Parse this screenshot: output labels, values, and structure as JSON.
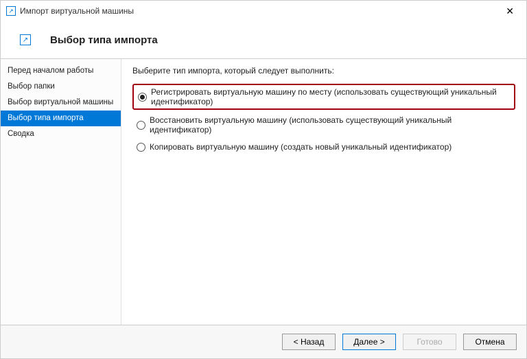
{
  "window": {
    "title": "Импорт виртуальной машины"
  },
  "header": {
    "title": "Выбор типа импорта"
  },
  "sidebar": {
    "steps": [
      {
        "label": "Перед началом работы",
        "selected": false
      },
      {
        "label": "Выбор папки",
        "selected": false
      },
      {
        "label": "Выбор виртуальной машины",
        "selected": false
      },
      {
        "label": "Выбор типа импорта",
        "selected": true
      },
      {
        "label": "Сводка",
        "selected": false
      }
    ]
  },
  "content": {
    "instruction": "Выберите тип импорта, который следует выполнить:",
    "options": [
      {
        "label": "Регистрировать виртуальную машину по месту (использовать существующий уникальный идентификатор)",
        "checked": true,
        "highlight": true
      },
      {
        "label": "Восстановить виртуальную машину (использовать существующий уникальный идентификатор)",
        "checked": false,
        "highlight": false
      },
      {
        "label": "Копировать виртуальную машину (создать новый уникальный идентификатор)",
        "checked": false,
        "highlight": false
      }
    ]
  },
  "footer": {
    "back": "< Назад",
    "next": "Далее >",
    "finish": "Готово",
    "cancel": "Отмена"
  }
}
